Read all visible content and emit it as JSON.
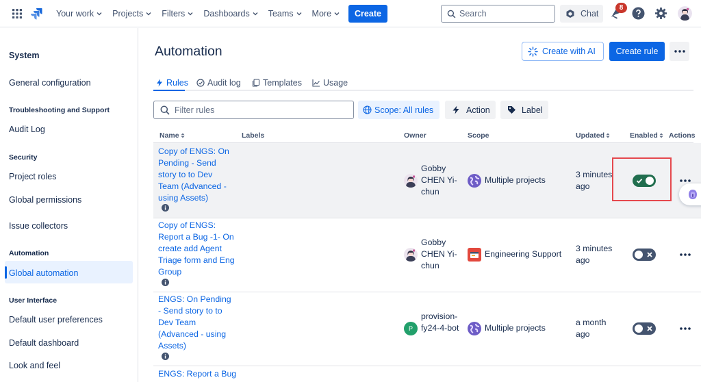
{
  "topbar": {
    "nav": [
      "Your work",
      "Projects",
      "Filters",
      "Dashboards",
      "Teams",
      "More"
    ],
    "create_label": "Create",
    "search_placeholder": "Search",
    "chat_label": "Chat",
    "notification_count": "8",
    "icons": [
      "app-switcher-icon",
      "jira-logo-icon",
      "search-icon",
      "chat-icon",
      "notification-bell-icon",
      "help-icon",
      "settings-gear-icon"
    ]
  },
  "sidebar": {
    "title": "System",
    "items": [
      {
        "type": "item",
        "label": "General configuration"
      },
      {
        "type": "section",
        "label": "Troubleshooting and Support"
      },
      {
        "type": "item",
        "label": "Audit Log"
      },
      {
        "type": "section",
        "label": "Security"
      },
      {
        "type": "item",
        "label": "Project roles"
      },
      {
        "type": "item",
        "label": "Global permissions"
      },
      {
        "type": "item",
        "label": "Issue collectors"
      },
      {
        "type": "section",
        "label": "Automation"
      },
      {
        "type": "item",
        "label": "Global automation",
        "active": true
      },
      {
        "type": "section",
        "label": "User Interface"
      },
      {
        "type": "item",
        "label": "Default user preferences"
      },
      {
        "type": "item",
        "label": "Default dashboard"
      },
      {
        "type": "item",
        "label": "Look and feel"
      }
    ]
  },
  "main": {
    "title": "Automation",
    "create_ai_label": "Create with AI",
    "create_rule_label": "Create rule",
    "tabs": [
      {
        "label": "Rules",
        "active": true
      },
      {
        "label": "Audit log"
      },
      {
        "label": "Templates"
      },
      {
        "label": "Usage"
      }
    ],
    "filter_placeholder": "Filter rules",
    "scope_filter_label": "Scope: All rules",
    "action_filter_label": "Action",
    "label_filter_label": "Label"
  },
  "table": {
    "columns": [
      "Name",
      "Labels",
      "Owner",
      "Scope",
      "Updated",
      "Enabled",
      "Actions"
    ],
    "rows": [
      {
        "name": "Copy of ENGS: On Pending - Send story to to Dev Team (Advanced - using Assets)",
        "owner": "Gobby CHEN Yi-chun",
        "scope": "Multiple projects",
        "updated": "3 minutes ago",
        "enabled": true
      },
      {
        "name": "Copy of ENGS: Report a Bug -1- On create add Agent Triage form and Eng Group",
        "owner": "Gobby CHEN Yi-chun",
        "scope": "Engineering Support",
        "updated": "3 minutes ago",
        "enabled": false
      },
      {
        "name": "ENGS: On Pending - Send story to to Dev Team (Advanced - using Assets)",
        "owner": "provision-fy24-4-bot",
        "owner_initial": "P",
        "scope": "Multiple projects",
        "updated": "a month ago",
        "enabled": false
      },
      {
        "name": "ENGS: Report a Bug",
        "owner": "",
        "scope": "",
        "updated": "",
        "enabled": null
      }
    ]
  },
  "colors": {
    "accent": "#0c66e4",
    "toggle_on": "#216e4e",
    "toggle_off": "#44546f",
    "highlight_box": "#e5484d",
    "row_highlight": "#f1f2f4"
  }
}
